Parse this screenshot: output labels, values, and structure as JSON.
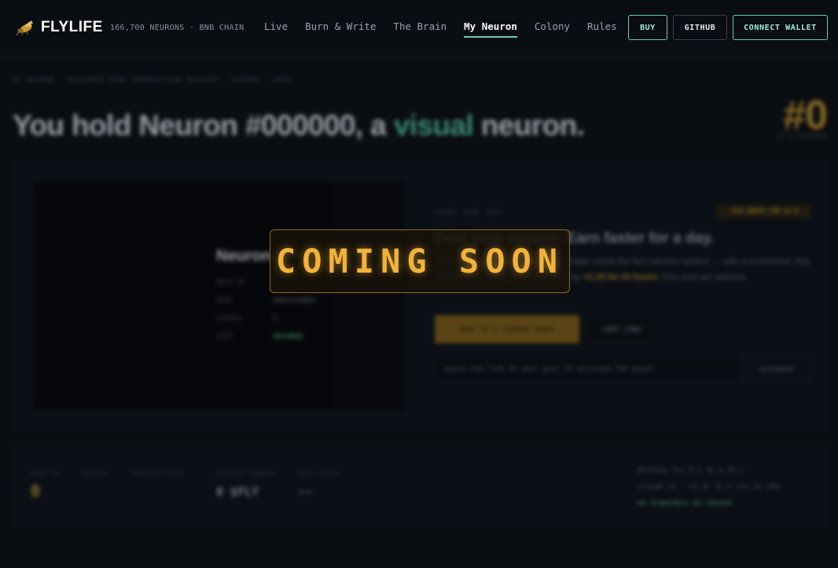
{
  "header": {
    "brand": "FLYLIFE",
    "tagline": "166,700 NEURONS · BNB CHAIN",
    "logo_icon": "fly-icon",
    "nav": [
      {
        "label": "Live",
        "active": false
      },
      {
        "label": "Burn & Write",
        "active": false
      },
      {
        "label": "The Brain",
        "active": false
      },
      {
        "label": "My Neuron",
        "active": true
      },
      {
        "label": "Colony",
        "active": false
      },
      {
        "label": "Rules",
        "active": false
      }
    ],
    "buttons": {
      "buy": "BUY",
      "github": "GITHUB",
      "connect": "CONNECT WALLET"
    }
  },
  "page": {
    "breadcrumb": "MY NEURON · ASSIGNED FROM TRANSACTION HISTORY · 0XE8AE...A0E8",
    "title_prefix": "You hold Neuron #000000, a ",
    "title_accent": "visual",
    "title_suffix": " neuron.",
    "rank": "#0",
    "rank_sub": "OF 0 INSPIRED"
  },
  "neuron_card": {
    "name": "Neuron",
    "props": [
      {
        "label": "HELD BY",
        "value": "",
        "good": false
      },
      {
        "label": "ROOC",
        "value": "UNASSIGNED",
        "good": false
      },
      {
        "label": "SURGES",
        "value": "5",
        "good": false
      },
      {
        "label": "SENT",
        "value": "SECURED",
        "good": true
      }
    ]
  },
  "share": {
    "eyebrow": "SHARE YOUR POST",
    "badge": "+25% BOOST FOR 24 H",
    "heading": "Post your neuron. Earn faster for a day.",
    "body_prefix": "Show off your neuron — its actual shape inside the fly's nervous system — with a screenshot. Any verified post multiplies your accrual by ",
    "body_highlight": "×1.25 for 24 hours",
    "body_suffix": ". One post per address.",
    "post_button": "POST TO X (COMING SOON)",
    "copy_button": "COPY LINK",
    "link_placeholder": "paste the link to your post to activate the boost",
    "activate_button": "ACTIVATE"
  },
  "stats": [
    {
      "label": "RANK IN",
      "value": "0",
      "gold": true
    },
    {
      "label": "REGION",
      "value": "",
      "gold": false
    },
    {
      "label": "INHERENT RATE",
      "value": "",
      "gold": false
    },
    {
      "label": "ACCRUED EARNED",
      "value": "0 $FLY",
      "gold": false
    },
    {
      "label": "HELD SINCE",
      "value": "--",
      "gold": false
    }
  ],
  "holding": {
    "line1": "Holding for 4 h 32 m 45 s",
    "line2": "stream ×1 · ×2 at 72 h (in 3d 19h)",
    "line3": "no transfers on record"
  },
  "overlay": {
    "text": "COMING SOON"
  }
}
